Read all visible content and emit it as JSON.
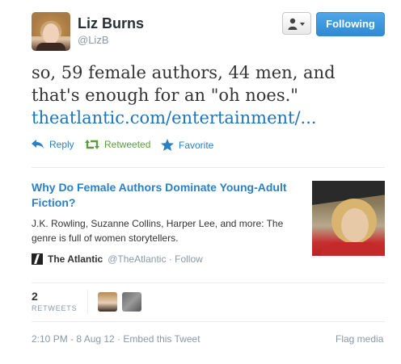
{
  "header": {
    "name": "Liz Burns",
    "handle": "@LizB",
    "follow_label": "Following"
  },
  "tweet": {
    "text": "so, 59 female authors, 44 men, and that's enough for an \"oh noes.\"",
    "link": "theatlantic.com/entertainment/..."
  },
  "actions": {
    "reply": "Reply",
    "retweeted": "Retweeted",
    "favorite": "Favorite"
  },
  "card": {
    "title": "Why Do Female Authors Dominate Young-Adult Fiction?",
    "description": "J.K. Rowling, Suzanne Collins, Harper Lee, and more: The genre is full of women storytellers.",
    "source_name": "The Atlantic",
    "source_handle": "@TheAtlantic · Follow"
  },
  "stats": {
    "retweet_count": "2",
    "retweet_label": "RETWEETS"
  },
  "footer": {
    "meta": "2:10 PM - 8 Aug 12 · Embed this Tweet",
    "flag": "Flag media"
  },
  "colors": {
    "link_blue": "#1f73b7",
    "follow_blue": "#2f8ad4",
    "retweet_green": "#5a9e3a",
    "muted_gray": "#8899a6"
  },
  "icons": [
    "user-icon",
    "caret-down-icon",
    "reply-icon",
    "retweet-icon",
    "star-icon",
    "atlantic-logo-icon"
  ]
}
